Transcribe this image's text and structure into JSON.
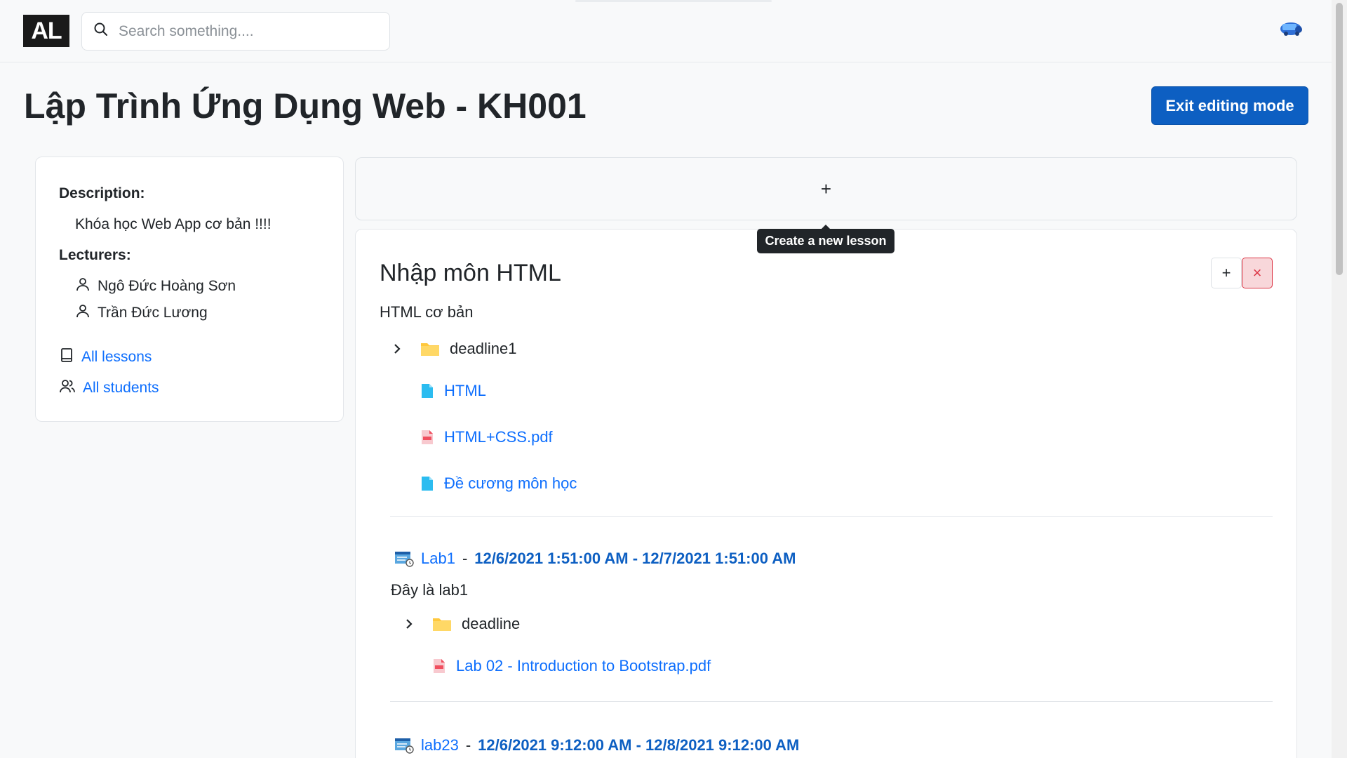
{
  "navbar": {
    "logo": "AL",
    "search_placeholder": "Search something...."
  },
  "page": {
    "title": "Lập Trình Ứng Dụng Web - KH001",
    "exit_button": "Exit editing mode"
  },
  "info": {
    "description_label": "Description:",
    "description": "Khóa học Web App cơ bản !!!!",
    "lecturers_label": "Lecturers:",
    "lecturers": [
      "Ngô Đức Hoàng Sơn",
      "Trần Đức Lương"
    ],
    "all_lessons": "All lessons",
    "all_students": "All students"
  },
  "create_lesson": {
    "plus": "+",
    "tooltip": "Create a new lesson"
  },
  "lesson": {
    "title": "Nhập môn HTML",
    "subtitle": "HTML cơ bản",
    "add": "+",
    "delete": "×",
    "folder": "deadline1",
    "files": [
      {
        "name": "HTML",
        "icon": "doc-icon"
      },
      {
        "name": "HTML+CSS.pdf",
        "icon": "pdf-icon"
      },
      {
        "name": "Đề cương môn học",
        "icon": "doc-icon"
      }
    ],
    "assignments": [
      {
        "name": "Lab1",
        "dates": "12/6/2021 1:51:00 AM - 12/7/2021 1:51:00 AM",
        "description": "Đây là lab1",
        "folder": "deadline",
        "file": "Lab 02 - Introduction to Bootstrap.pdf"
      },
      {
        "name": "lab23",
        "dates": "12/6/2021 9:12:00 AM - 12/8/2021 9:12:00 AM"
      }
    ],
    "separator": "-"
  },
  "colors": {
    "primary": "#0d5fc2",
    "link": "#0d6efd",
    "danger": "#dc3545",
    "folder": "#ffc83d",
    "doc": "#2bbcf0",
    "pdf": "#f04f5f"
  }
}
